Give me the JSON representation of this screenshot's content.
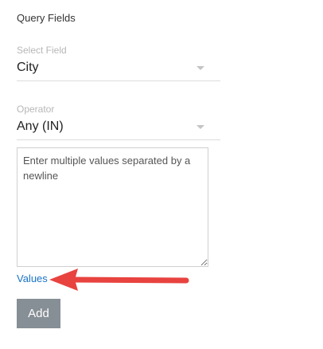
{
  "section": {
    "title": "Query Fields"
  },
  "select_field": {
    "label": "Select Field",
    "value": "City",
    "icon": "caret-down-icon"
  },
  "operator": {
    "label": "Operator",
    "value": "Any (IN)",
    "icon": "caret-down-icon"
  },
  "values_input": {
    "placeholder": "Enter multiple values separated by a newline",
    "value": ""
  },
  "values_link": {
    "label": "Values"
  },
  "add_button": {
    "label": "Add"
  },
  "annotation": {
    "icon": "red-arrow-icon",
    "color": "#e8433f"
  },
  "colors": {
    "link": "#1a73c6",
    "button_bg": "#868e96",
    "label_gray": "#b7b7b7"
  }
}
